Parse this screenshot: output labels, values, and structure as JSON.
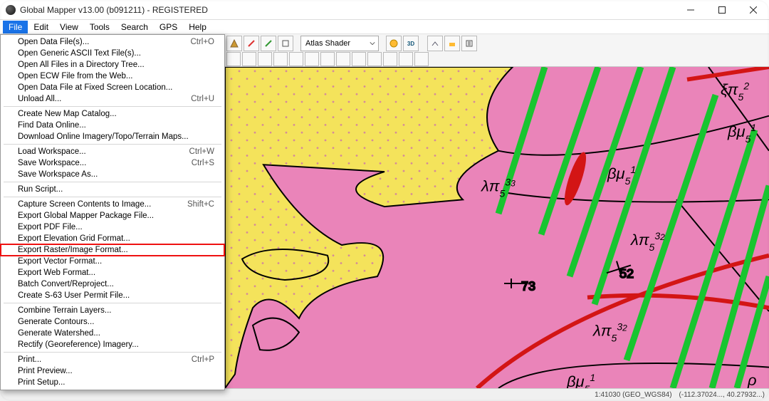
{
  "window": {
    "title": "Global Mapper v13.00 (b091211) - REGISTERED"
  },
  "menubar": [
    "File",
    "Edit",
    "View",
    "Tools",
    "Search",
    "GPS",
    "Help"
  ],
  "active_menu": "File",
  "shader_select": {
    "value": "Atlas Shader"
  },
  "file_menu": {
    "groups": [
      [
        {
          "label": "Open Data File(s)...",
          "shortcut": "Ctrl+O"
        },
        {
          "label": "Open Generic ASCII Text File(s)..."
        },
        {
          "label": "Open All Files in a Directory Tree..."
        },
        {
          "label": "Open ECW File from the Web..."
        },
        {
          "label": "Open Data File at Fixed Screen Location..."
        },
        {
          "label": "Unload All...",
          "shortcut": "Ctrl+U"
        }
      ],
      [
        {
          "label": "Create New Map Catalog..."
        },
        {
          "label": "Find Data Online..."
        },
        {
          "label": "Download Online Imagery/Topo/Terrain Maps..."
        }
      ],
      [
        {
          "label": "Load Workspace...",
          "shortcut": "Ctrl+W"
        },
        {
          "label": "Save Workspace...",
          "shortcut": "Ctrl+S"
        },
        {
          "label": "Save Workspace As..."
        }
      ],
      [
        {
          "label": "Run Script..."
        }
      ],
      [
        {
          "label": "Capture Screen Contents to Image...",
          "shortcut": "Shift+C"
        },
        {
          "label": "Export Global Mapper Package File..."
        },
        {
          "label": "Export PDF File..."
        },
        {
          "label": "Export Elevation Grid Format..."
        },
        {
          "label": "Export Raster/Image Format...",
          "highlight": true
        },
        {
          "label": "Export Vector Format..."
        },
        {
          "label": "Export Web Format..."
        },
        {
          "label": "Batch Convert/Reproject..."
        },
        {
          "label": "Create S-63 User Permit File..."
        }
      ],
      [
        {
          "label": "Combine Terrain Layers..."
        },
        {
          "label": "Generate Contours..."
        },
        {
          "label": "Generate Watershed..."
        },
        {
          "label": "Rectify (Georeference) Imagery..."
        }
      ],
      [
        {
          "label": "Print...",
          "shortcut": "Ctrl+P"
        },
        {
          "label": "Print Preview..."
        },
        {
          "label": "Print Setup..."
        }
      ]
    ]
  },
  "map_labels": {
    "l1": "λπ",
    "l2": "βμ",
    "l3": "ξπ",
    "a1": "73",
    "a2": "52"
  },
  "status": {
    "left": "1:41030  (GEO_WGS84)",
    "right": "(-112.37024..., 40.27932...)"
  }
}
